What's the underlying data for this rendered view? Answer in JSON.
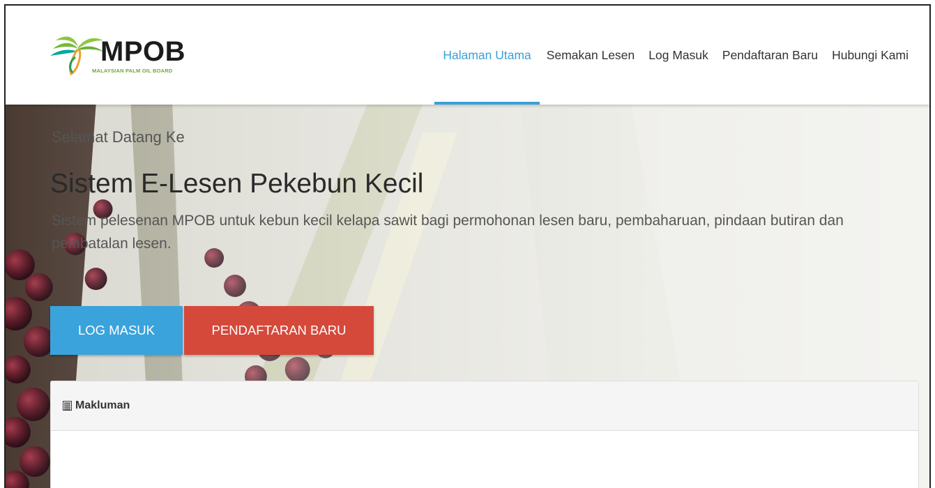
{
  "brand": {
    "name": "MPOB",
    "subtitle": "MALAYSIAN PALM OIL BOARD"
  },
  "nav": {
    "items": [
      {
        "label": "Halaman Utama",
        "active": true
      },
      {
        "label": "Semakan Lesen",
        "active": false
      },
      {
        "label": "Log Masuk",
        "active": false
      },
      {
        "label": "Pendaftaran Baru",
        "active": false
      },
      {
        "label": "Hubungi Kami",
        "active": false
      }
    ]
  },
  "hero": {
    "welcome": "Selamat Datang Ke",
    "title": "Sistem E-Lesen Pekebun Kecil",
    "description": "Sistem pelesenan MPOB untuk kebun kecil kelapa sawit bagi permohonan lesen baru, pembaharuan, pindaan butiran dan pembatalan lesen."
  },
  "buttons": {
    "login": "LOG MASUK",
    "register": "PENDAFTARAN BARU"
  },
  "panel": {
    "title": "Makluman",
    "icon": "list-icon"
  },
  "colors": {
    "accent": "#3aa0d6",
    "login_button": "#3aa3dc",
    "register_button": "#d5493b",
    "brand_green": "#6da836"
  }
}
